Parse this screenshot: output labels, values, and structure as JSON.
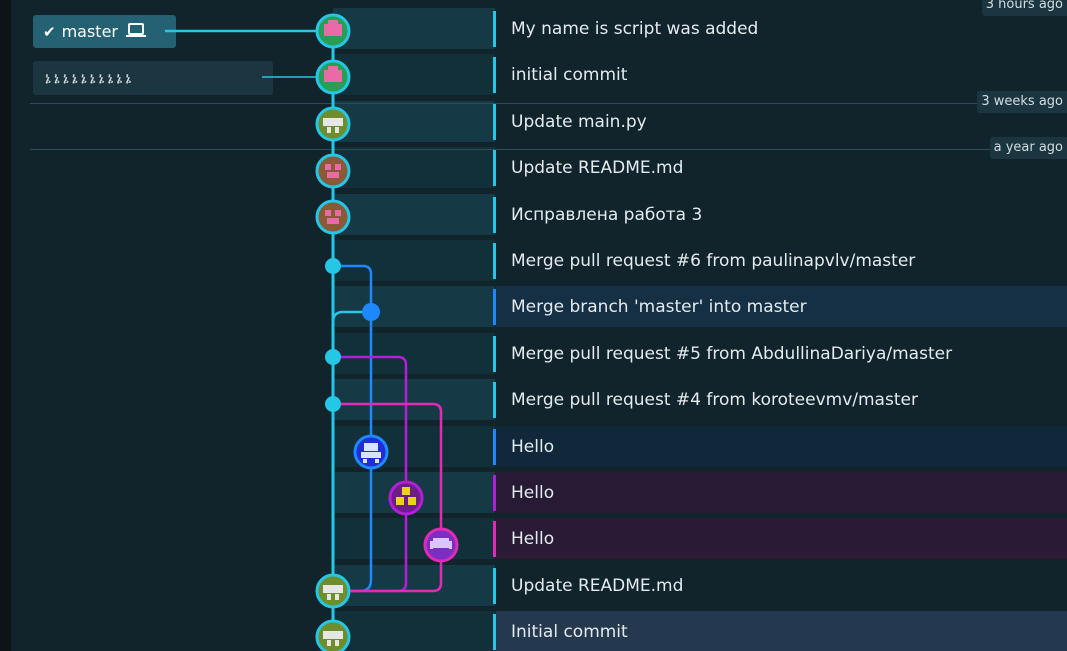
{
  "branch": {
    "name": "master",
    "check_icon": "✔",
    "laptop_icon": "laptop-icon"
  },
  "tags": {
    "text": "ኔኔኔኔኔኔኔኔኔኔ"
  },
  "time_labels": [
    "3 hours ago",
    "3 weeks ago",
    "a year ago"
  ],
  "commits": [
    {
      "message": "My name is script was added"
    },
    {
      "message": "initial commit"
    },
    {
      "message": "Update main.py"
    },
    {
      "message": "Update README.md"
    },
    {
      "message": "Исправлена работа 3"
    },
    {
      "message": "Merge pull request #6 from paulinapvlv/master"
    },
    {
      "message": "Merge branch 'master' into master"
    },
    {
      "message": "Merge pull request #5 from AbdullinaDariya/master"
    },
    {
      "message": "Merge pull request #4 from koroteevmv/master"
    },
    {
      "message": "Hello"
    },
    {
      "message": "Hello"
    },
    {
      "message": "Hello"
    },
    {
      "message": "Update README.md"
    },
    {
      "message": "Initial commit"
    }
  ],
  "colors": {
    "main": "#25c7e6",
    "blue": "#1e88ff",
    "purple": "#b11fd6",
    "magenta": "#e22ab6",
    "selected": "#24394f"
  }
}
